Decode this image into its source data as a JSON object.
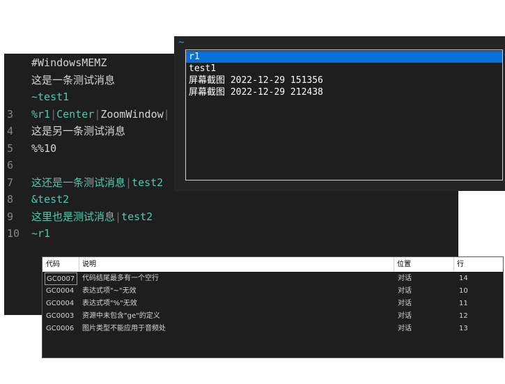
{
  "editor": {
    "lines": [
      {
        "num": "",
        "segments": [
          {
            "text": "#WindowsMEMZ",
            "cls": ""
          }
        ]
      },
      {
        "num": "",
        "segments": [
          {
            "text": "这是一条测试消息",
            "cls": "cjk"
          }
        ]
      },
      {
        "num": "",
        "segments": [
          {
            "text": "~test1",
            "cls": "teal"
          }
        ]
      },
      {
        "num": "3",
        "segments": [
          {
            "text": "%r1",
            "cls": "teal"
          },
          {
            "text": "|",
            "cls": "dim"
          },
          {
            "text": "Center",
            "cls": "teal"
          },
          {
            "text": "|",
            "cls": "dim"
          },
          {
            "text": "ZoomWindow",
            "cls": ""
          },
          {
            "text": "|",
            "cls": "dim"
          }
        ]
      },
      {
        "num": "4",
        "segments": [
          {
            "text": "这是另一条测试消息",
            "cls": "cjk"
          }
        ]
      },
      {
        "num": "5",
        "segments": [
          {
            "text": "%%10",
            "cls": ""
          }
        ]
      },
      {
        "num": "6",
        "segments": []
      },
      {
        "num": "7",
        "segments": [
          {
            "text": "这还是一条测试消息",
            "cls": "cjk teal"
          },
          {
            "text": "|",
            "cls": "dim"
          },
          {
            "text": "test2",
            "cls": "teal"
          }
        ]
      },
      {
        "num": "8",
        "segments": [
          {
            "text": "&test2",
            "cls": "teal"
          }
        ]
      },
      {
        "num": "9",
        "segments": [
          {
            "text": "这里也是测试消息",
            "cls": "cjk teal"
          },
          {
            "text": "|",
            "cls": "dim"
          },
          {
            "text": "test2",
            "cls": "teal"
          }
        ]
      },
      {
        "num": "10",
        "segments": [
          {
            "text": "~r1",
            "cls": "teal"
          }
        ]
      }
    ]
  },
  "popup": {
    "input_text": "~",
    "options": [
      "r1",
      "test1",
      "屏幕截图 2022-12-29 151356",
      "屏幕截图 2022-12-29 212438"
    ],
    "selected_index": 0
  },
  "errors": {
    "headers": {
      "code": "代码",
      "desc": "说明",
      "location": "位置",
      "line": "行"
    },
    "rows": [
      {
        "code": "GC0007",
        "desc": "代码结尾最多有一个空行",
        "location": "对话",
        "line": "14"
      },
      {
        "code": "GC0004",
        "desc": "表达式项\"~\"无效",
        "location": "对话",
        "line": "10"
      },
      {
        "code": "GC0004",
        "desc": "表达式项\"%\"无效",
        "location": "对话",
        "line": "11"
      },
      {
        "code": "GC0003",
        "desc": "资源中未包含\"ge\"的定义",
        "location": "对话",
        "line": "12"
      },
      {
        "code": "GC0006",
        "desc": "图片类型不能应用于音频处",
        "location": "对话",
        "line": "13"
      }
    ]
  }
}
